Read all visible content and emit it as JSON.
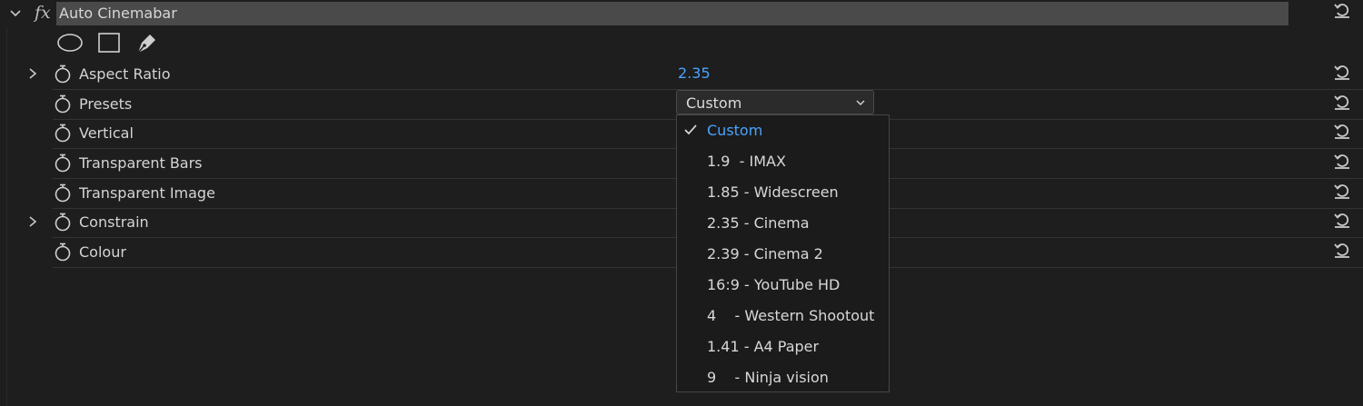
{
  "effect": {
    "fx_symbol": "fx",
    "title": "Auto Cinemabar"
  },
  "mask_tools": [
    "ellipse-mask-icon",
    "rectangle-mask-icon",
    "pen-mask-icon"
  ],
  "properties": [
    {
      "label": "Aspect Ratio",
      "value": "2.35",
      "has_twirl": true
    },
    {
      "label": "Presets",
      "has_twirl": false
    },
    {
      "label": "Vertical",
      "has_twirl": false
    },
    {
      "label": "Transparent Bars",
      "has_twirl": false
    },
    {
      "label": "Transparent Image",
      "has_twirl": false
    },
    {
      "label": "Constrain",
      "has_twirl": true
    },
    {
      "label": "Colour",
      "has_twirl": false
    }
  ],
  "presets_dropdown": {
    "selected": "Custom",
    "options": [
      "Custom",
      "1.9  - IMAX",
      "1.85 - Widescreen",
      "2.35 - Cinema",
      "2.39 - Cinema 2",
      "16:9 - YouTube HD",
      "4    - Western Shootout",
      "1.41 - A4 Paper",
      "9    - Ninja vision"
    ]
  },
  "colors": {
    "accent": "#4aa3ff",
    "header_bar": "#4a4a4a",
    "background": "#1e1e1e"
  }
}
